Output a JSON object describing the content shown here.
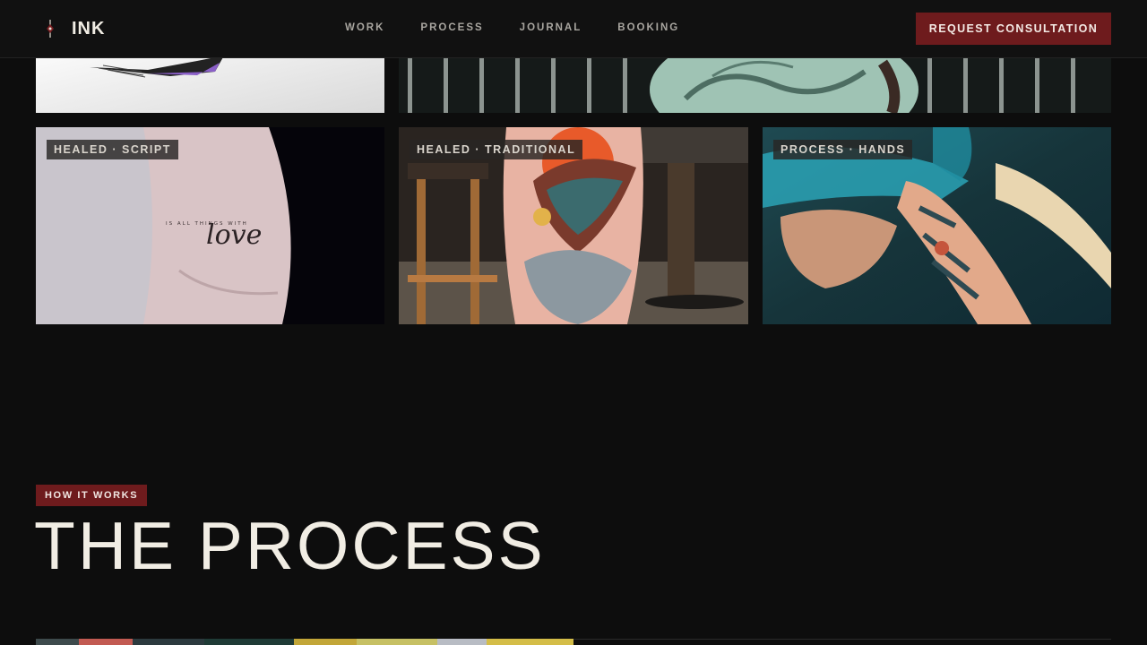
{
  "nav": {
    "brand": "INK",
    "links": [
      "WORK",
      "PROCESS",
      "JOURNAL",
      "BOOKING"
    ],
    "cta": "REQUEST CONSULTATION"
  },
  "gallery": {
    "tiles": [
      {
        "tag": ""
      },
      {
        "tag": ""
      },
      {
        "tag": "HEALED · SCRIPT",
        "script_text": "love",
        "small_text": "IS ALL THINGS WITH"
      },
      {
        "tag": "HEALED · TRADITIONAL"
      },
      {
        "tag": "PROCESS · HANDS"
      }
    ]
  },
  "process": {
    "eyebrow": "HOW IT WORKS",
    "title": "THE PROCESS"
  },
  "colors": {
    "background": "#0d0d0d",
    "accent": "#6e1b1d",
    "text": "#f1ede4",
    "muted": "#a9a6a0"
  },
  "icons": {
    "brand": "needle-mark-icon"
  }
}
